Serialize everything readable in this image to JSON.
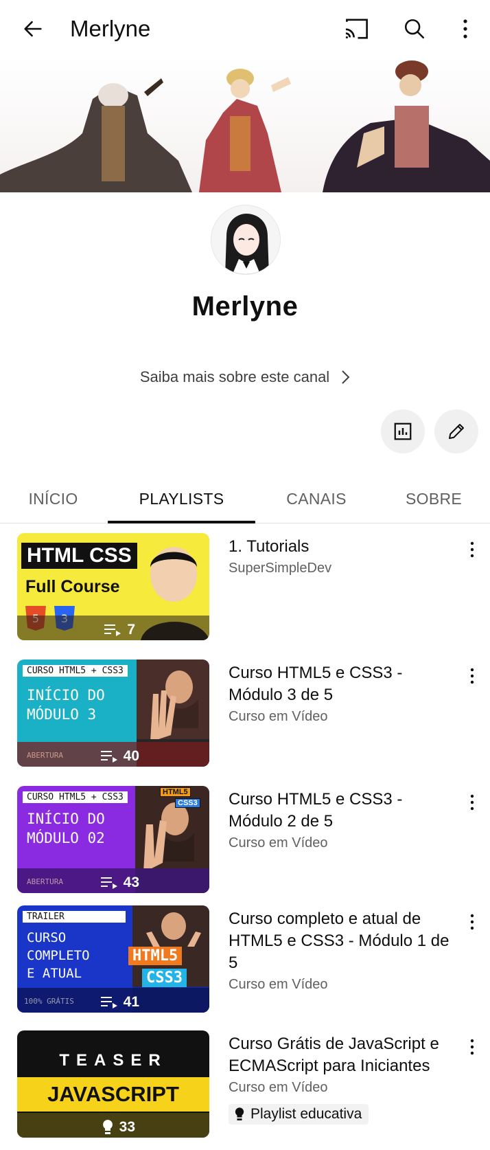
{
  "appbar": {
    "title": "Merlyne"
  },
  "channel": {
    "name": "Merlyne",
    "about_link": "Saiba mais sobre este canal"
  },
  "tabs": [
    {
      "label": "INÍCIO",
      "active": false
    },
    {
      "label": "PLAYLISTS",
      "active": true
    },
    {
      "label": "CANAIS",
      "active": false
    },
    {
      "label": "SOBRE",
      "active": false
    }
  ],
  "playlists": [
    {
      "title": "1. Tutorials",
      "author": "SuperSimpleDev",
      "count": "7",
      "thumb_line1": "HTML CSS",
      "thumb_line2": "Full Course"
    },
    {
      "title": "Curso HTML5 e CSS3 - Módulo 3 de 5",
      "author": "Curso em Vídeo",
      "count": "40",
      "thumb_tag": "CURSO HTML5 + CSS3",
      "thumb_line1": "INÍCIO DO",
      "thumb_line2": "MÓDULO 3",
      "thumb_footer": "ABERTURA"
    },
    {
      "title": "Curso HTML5 e CSS3 - Módulo 2 de 5",
      "author": "Curso em Vídeo",
      "count": "43",
      "thumb_tag": "CURSO HTML5 + CSS3",
      "thumb_line1": "INÍCIO DO",
      "thumb_line2": "MÓDULO 02",
      "thumb_footer": "ABERTURA",
      "thumb_logo1": "HTML5",
      "thumb_logo2": "CSS3"
    },
    {
      "title": "Curso completo e atual de HTML5 e CSS3 - Módulo 1 de 5",
      "author": "Curso em Vídeo",
      "count": "41",
      "thumb_tag": "TRAILER",
      "thumb_line1": "CURSO",
      "thumb_line2": "COMPLETO",
      "thumb_line3": "E ATUAL",
      "thumb_footer": "100% GRÁTIS",
      "thumb_logo1": "HTML5",
      "thumb_logo2": "CSS3"
    },
    {
      "title": "Curso Grátis de JavaScript e ECMAScript para Iniciantes",
      "author": "Curso em Vídeo",
      "count": "33",
      "thumb_line1": "TEASER",
      "thumb_line2": "JAVASCRIPT",
      "badge": "Playlist educativa"
    }
  ]
}
